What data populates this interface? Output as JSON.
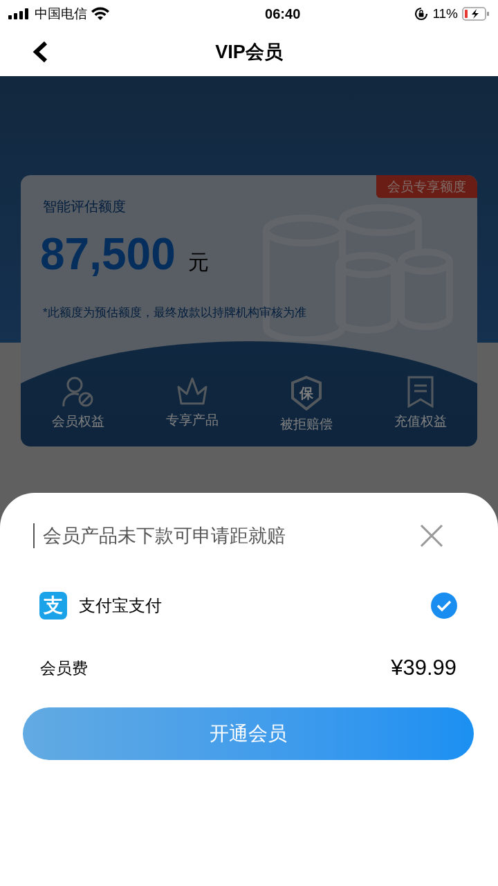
{
  "status_bar": {
    "carrier": "中国电信",
    "time": "06:40",
    "battery": "11%"
  },
  "nav": {
    "title": "VIP会员"
  },
  "card": {
    "badge": "会员专享额度",
    "label": "智能评估额度",
    "amount": "87,500",
    "unit": "元",
    "note": "*此额度为预估额度，最终放款以持牌机构审核为准",
    "features": [
      {
        "kind": "person",
        "label": "会员权益"
      },
      {
        "kind": "crown",
        "label": "专享产品"
      },
      {
        "kind": "shield",
        "glyph": "保",
        "label": "被拒赔偿"
      },
      {
        "kind": "bookmark",
        "label": "充值权益"
      }
    ]
  },
  "sheet": {
    "title": "会员产品未下款可申请距就赔",
    "payment": {
      "name": "支付宝支付",
      "logo": "支",
      "selected": true
    },
    "fee": {
      "label": "会员费",
      "price": "¥39.99"
    },
    "button": "开通会员"
  }
}
